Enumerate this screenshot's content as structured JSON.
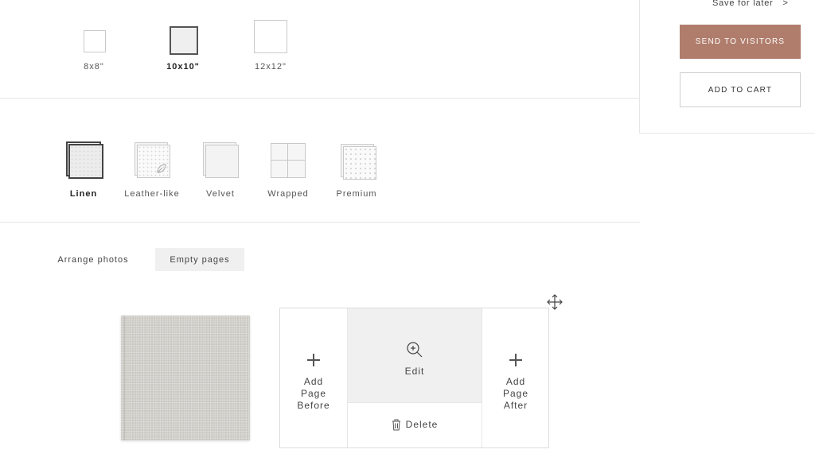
{
  "sizes": {
    "options": [
      {
        "label": "8x8\"",
        "selected": false
      },
      {
        "label": "10x10\"",
        "selected": true
      },
      {
        "label": "12x12\"",
        "selected": false
      }
    ]
  },
  "panel": {
    "save_for_later": "Save for later",
    "save_chevron": ">",
    "send_to_visitors": "SEND TO VISITORS",
    "add_to_cart": "ADD TO CART",
    "accent_color": "#b07d6c"
  },
  "materials": {
    "options": [
      {
        "label": "Linen",
        "selected": true
      },
      {
        "label": "Leather-like",
        "selected": false
      },
      {
        "label": "Velvet",
        "selected": false
      },
      {
        "label": "Wrapped",
        "selected": false
      },
      {
        "label": "Premium",
        "selected": false
      }
    ]
  },
  "tabs": [
    {
      "label": "Arrange photos",
      "active": false
    },
    {
      "label": "Empty pages",
      "active": true
    }
  ],
  "editor": {
    "add_before": [
      "Add",
      "Page",
      "Before"
    ],
    "edit": "Edit",
    "delete": "Delete",
    "add_after": [
      "Add",
      "Page",
      "After"
    ]
  },
  "icons": {
    "move": "move-icon",
    "zoom": "zoom-in-icon",
    "trash": "trash-icon",
    "plus": "plus-icon"
  }
}
